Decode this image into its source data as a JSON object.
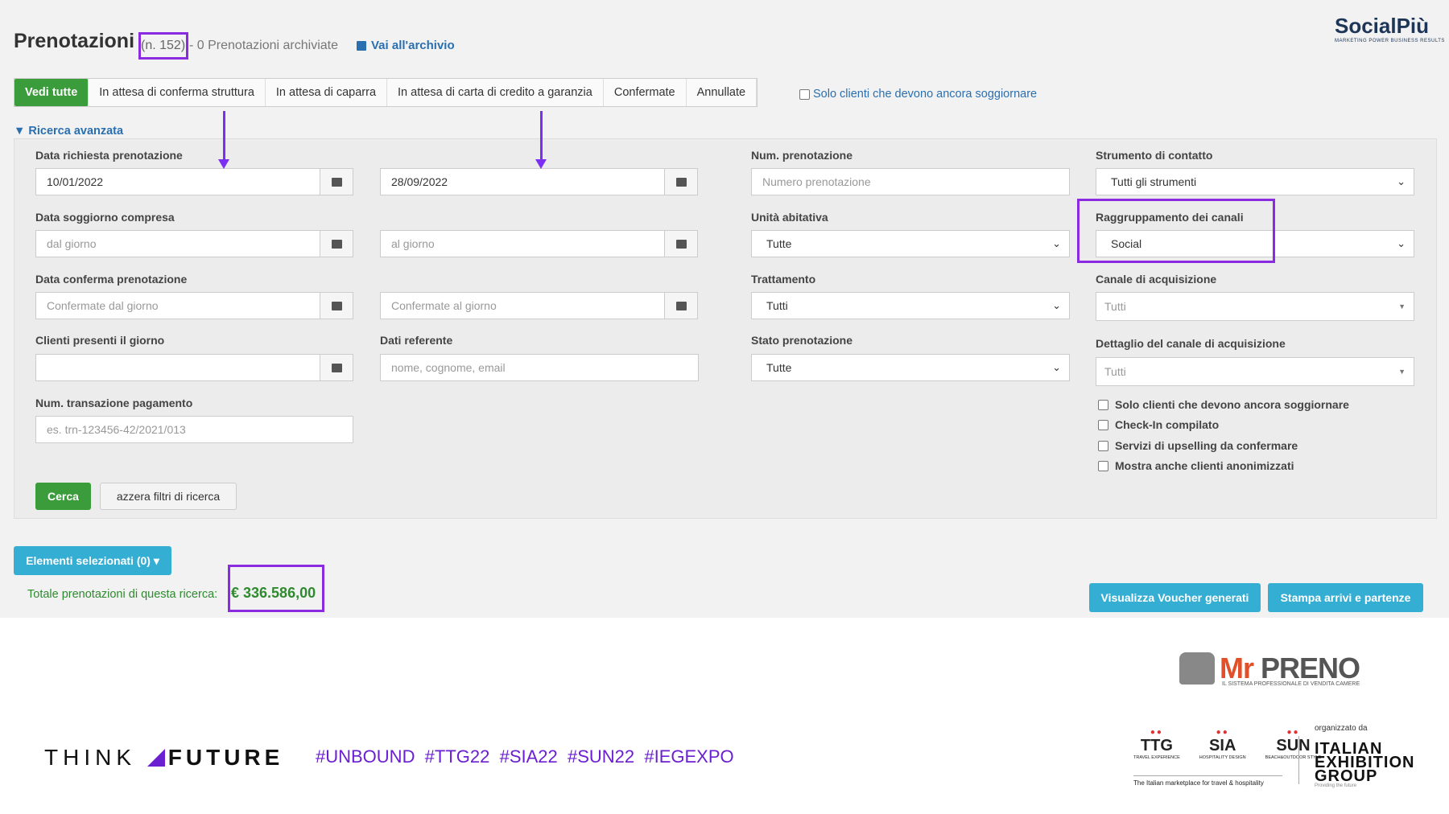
{
  "header": {
    "title": "Prenotazioni",
    "count": "(n. 152)",
    "archived": "- 0 Prenotazioni archiviate",
    "archive_link": "Vai all'archivio",
    "brand": "SocialPiù",
    "brand_tagline": "MARKETING POWER BUSINESS RESULTS"
  },
  "tabs": [
    "Vedi tutte",
    "In attesa di conferma struttura",
    "In attesa di caparra",
    "In attesa di carta di credito a garanzia",
    "Confermate",
    "Annullate"
  ],
  "only_clients_toggle": "Solo clienti che devono ancora soggiornare",
  "advanced_search": "Ricerca avanzata",
  "form": {
    "data_richiesta_label": "Data richiesta prenotazione",
    "data_richiesta_from": "10/01/2022",
    "data_richiesta_to": "28/09/2022",
    "data_soggiorno_label": "Data soggiorno compresa",
    "data_soggiorno_from_ph": "dal giorno",
    "data_soggiorno_to_ph": "al giorno",
    "data_conferma_label": "Data conferma prenotazione",
    "data_conferma_from_ph": "Confermate dal giorno",
    "data_conferma_to_ph": "Confermate al giorno",
    "clienti_presenti_label": "Clienti presenti il giorno",
    "dati_referente_label": "Dati referente",
    "dati_referente_ph": "nome, cognome, email",
    "num_transazione_label": "Num. transazione pagamento",
    "num_transazione_ph": "es. trn-123456-42/2021/013",
    "num_prenotazione_label": "Num. prenotazione",
    "num_prenotazione_ph": "Numero prenotazione",
    "unita_label": "Unità abitativa",
    "unita_value": "Tutte",
    "trattamento_label": "Trattamento",
    "trattamento_value": "Tutti",
    "stato_label": "Stato prenotazione",
    "stato_value": "Tutte",
    "strumento_label": "Strumento di contatto",
    "strumento_value": "Tutti gli strumenti",
    "raggruppamento_label": "Raggruppamento dei canali",
    "raggruppamento_value": "Social",
    "canale_label": "Canale di acquisizione",
    "canale_value": "Tutti",
    "dettaglio_label": "Dettaglio del canale di acquisizione",
    "dettaglio_value": "Tutti",
    "checkboxes": [
      "Solo clienti che devono ancora soggiornare",
      "Check-In compilato",
      "Servizi di upselling da confermare",
      "Mostra anche clienti anonimizzati"
    ],
    "search_button": "Cerca",
    "reset_button": "azzera filtri di ricerca"
  },
  "selected_button": "Elementi selezionati (0)",
  "total_label": "Totale prenotazioni di questa ricerca:",
  "total_value": "€ 336.586,00",
  "voucher_button": "Visualizza Voucher generati",
  "print_button": "Stampa arrivi e partenze",
  "footer": {
    "think": "THINK",
    "future": "FUTURE",
    "hashtags": "#UNBOUND  #TTG22  #SIA22  #SUN22  #IEGEXPO",
    "mrpreno_a": "Mr",
    "mrpreno_b": "PRENO",
    "mrpreno_sub": "IL SISTEMA PROFESSIONALE DI VENDITA CAMERE",
    "ttg": "TTG",
    "ttg_sub": "TRAVEL EXPERIENCE",
    "sia": "SIA",
    "sia_sub": "HOSPITALITY DESIGN",
    "sun": "SUN",
    "sun_sub": "BEACH&OUTDOOR STYLE",
    "marketplace": "The Italian marketplace for travel & hospitality",
    "organized": "organizzato da",
    "ieg1": "ITALIAN",
    "ieg2": "EXHIBITION",
    "ieg3": "GROUP",
    "ieg_sub": "Providing the future"
  },
  "colors": {
    "accent_green": "#3b9c3b",
    "link_blue": "#2a6fb0",
    "button_blue": "#35aed3",
    "highlight_purple": "#8a2be2"
  }
}
